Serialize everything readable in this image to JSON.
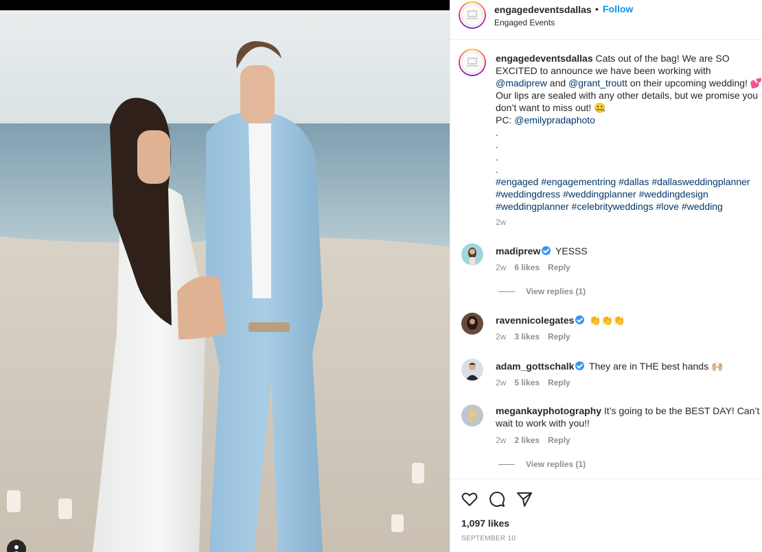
{
  "post": {
    "username": "engagedeventsdallas",
    "subtitle": "Engaged Events",
    "follow_label": "Follow",
    "dot": "•"
  },
  "caption": {
    "username": "engagedeventsdallas",
    "text1": " Cats out of the bag! We are SO EXCITED to announce we have been working with ",
    "mention1": "@madiprew",
    "text2": " and ",
    "mention2": "@grant_troutt",
    "text3": " on their upcoming wedding! 💕 Our lips are sealed with any other details, but we promise you don’t want to miss out! 🤐",
    "pc_label": "PC: ",
    "mention3": "@emilypradaphoto",
    "dots": [
      ".",
      ".",
      ".",
      "."
    ],
    "hashtags": [
      "#engaged",
      "#engagementring",
      "#dallas",
      "#dallasweddingplanner",
      "#weddingdress",
      "#weddingplanner",
      "#weddingdesign",
      "#weddingplanner",
      "#celebrityweddings",
      "#love",
      "#wedding"
    ],
    "time": "2w"
  },
  "comments": [
    {
      "username": "madiprew",
      "text": " YESSS",
      "time": "2w",
      "likes": "6 likes",
      "reply": "Reply",
      "view_replies": "View replies (1)"
    },
    {
      "username": "ravennicolegates",
      "text": " 👏👏👏",
      "time": "2w",
      "likes": "3 likes",
      "reply": "Reply"
    },
    {
      "username": "adam_gottschalk",
      "text": " They are in THE best hands 🙌🏼",
      "time": "2w",
      "likes": "5 likes",
      "reply": "Reply"
    },
    {
      "username": "megankayphotography",
      "text": " It’s going to be the BEST DAY! Can’t wait to work with you!!",
      "time": "2w",
      "likes": "2 likes",
      "reply": "Reply",
      "view_replies": "View replies (1)"
    }
  ],
  "footer": {
    "likes": "1,097 likes",
    "date": "SEPTEMBER 10"
  },
  "icons": {
    "like": "heart-icon",
    "comment": "comment-icon",
    "share": "share-icon",
    "verified": "verified-badge-icon"
  },
  "colors": {
    "link": "#00376b",
    "follow": "#0095f6",
    "muted": "#8e8e8e",
    "verified": "#3897f0"
  }
}
